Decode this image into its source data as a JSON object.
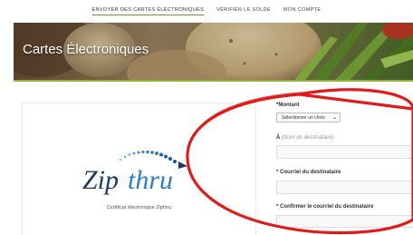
{
  "nav": {
    "items": [
      {
        "label": "ENVOYER DES CARTES ÉLECTRONIQUES",
        "active": true
      },
      {
        "label": "VÉRIFIER LE SOLDE",
        "active": false
      },
      {
        "label": "MON COMPTE",
        "active": false
      }
    ]
  },
  "hero": {
    "title": "Cartes Électroniques",
    "accent_color": "#8fb33a"
  },
  "card": {
    "logo": {
      "word_dark": "Zip",
      "word_light": "thru",
      "color_dark": "#1f3a63",
      "color_light": "#2f7fc4",
      "icon": "zipthru-arrow-logo"
    },
    "caption": "Certificat électronique Zipthru"
  },
  "form": {
    "amount_label": "*Montant",
    "amount_select_value": "Sélectionner un choix",
    "recipient_label": "À",
    "recipient_hint": "(Nom du destinataire)",
    "email_label": "* Courriel du destinataire",
    "confirm_email_label": "* Confirmer le courriel du destinataire"
  },
  "annotation": {
    "shape": "ellipse",
    "color": "#e01b1b"
  }
}
